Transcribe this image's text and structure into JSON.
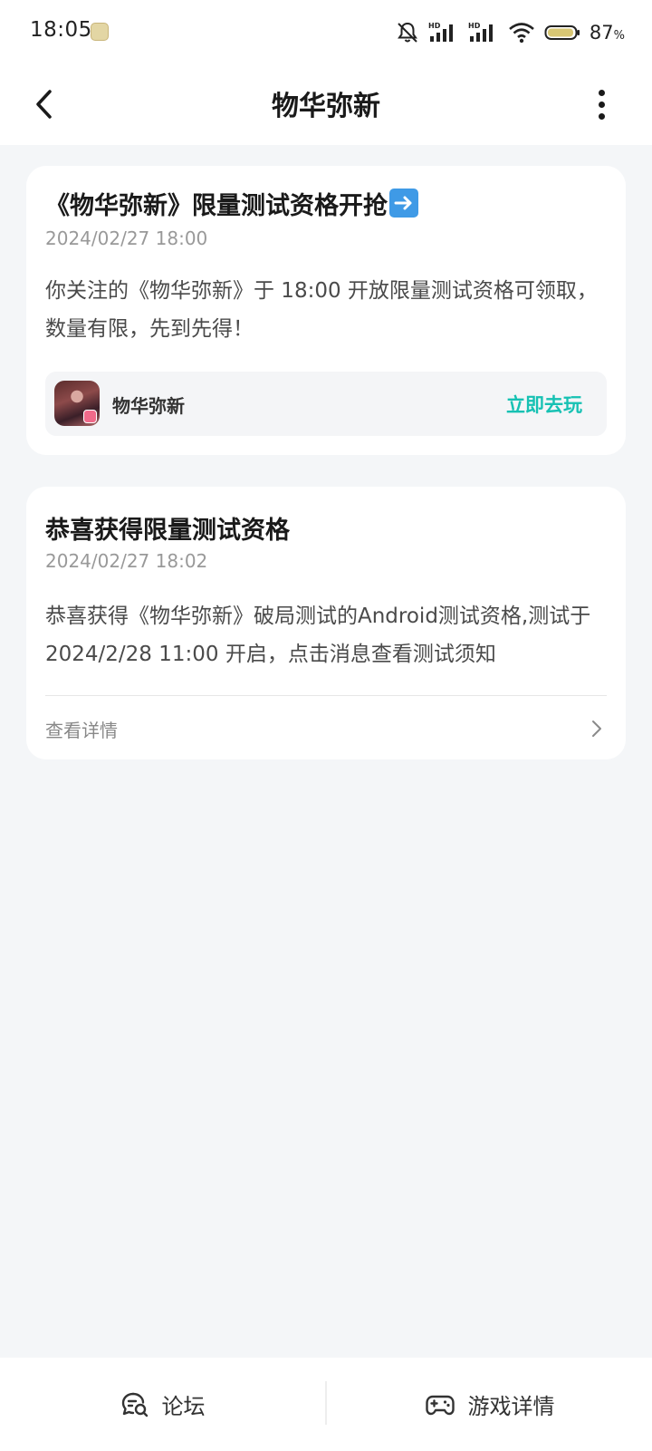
{
  "status_bar": {
    "time": "18:05",
    "battery_percent": "87",
    "battery_unit": "%",
    "icons": [
      "silent-bell-icon",
      "hd-signal-icon",
      "hd-signal-icon",
      "wifi-icon",
      "battery-icon"
    ]
  },
  "nav": {
    "title": "物华弥新",
    "back_icon": "chevron-left-icon",
    "more_icon": "more-vertical-icon"
  },
  "messages": [
    {
      "title": "《物华弥新》限量测试资格开抢",
      "title_emoji": "right-arrow-emoji",
      "time": "2024/02/27 18:00",
      "body": "你关注的《物华弥新》于 18:00 开放限量测试资格可领取，数量有限，先到先得！",
      "game_name": "物华弥新",
      "action_label": "立即去玩"
    },
    {
      "title": "恭喜获得限量测试资格",
      "time": "2024/02/27 18:02",
      "body": "恭喜获得《物华弥新》破局测试的Android测试资格,测试于 2024/2/28 11:00 开启，点击消息查看测试须知",
      "link_label": "查看详情"
    }
  ],
  "bottom_bar": {
    "forum_label": "论坛",
    "game_detail_label": "游戏详情"
  },
  "colors": {
    "accent": "#16c1b3",
    "background": "#f4f6f8",
    "card": "#ffffff"
  }
}
